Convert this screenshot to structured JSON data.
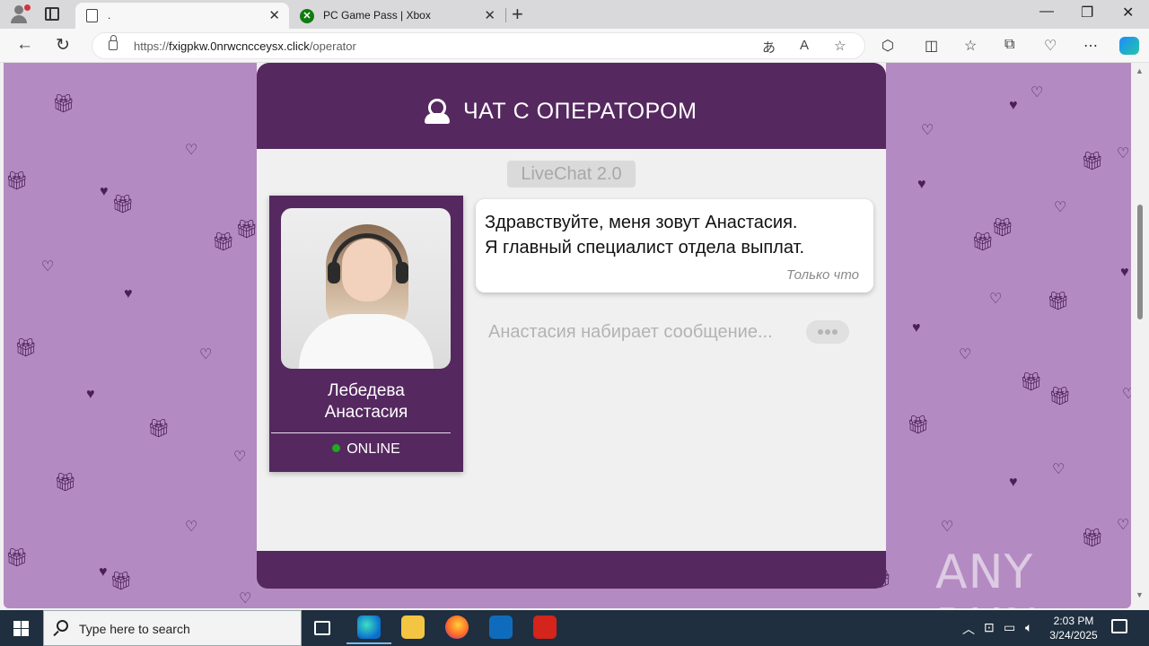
{
  "browser": {
    "tabs": [
      {
        "title": ".",
        "active": true
      },
      {
        "title": "PC Game Pass | Xbox",
        "active": false
      }
    ],
    "url_prefix": "https://",
    "url_host": "fxigpkw.0nrwcncceysx.click",
    "url_path": "/operator"
  },
  "chat": {
    "header_title": "ЧАТ С ОПЕРАТОРОМ",
    "badge": "LiveChat 2.0",
    "operator_name_line1": "Лебедева",
    "operator_name_line2": "Анастасия",
    "status": "ONLINE",
    "message_line1": "Здравствуйте, меня зовут Анастасия.",
    "message_line2": "Я главный специалист отдела выплат.",
    "message_time": "Только что",
    "typing_text": "Анастасия набирает сообщение..."
  },
  "watermark": "ANY RUN",
  "taskbar": {
    "search_placeholder": "Type here to search",
    "time": "2:03 PM",
    "date": "3/24/2025"
  },
  "colors": {
    "page_background": "#b48ac2",
    "brand_purple": "#55285f",
    "status_online": "#1faa1f"
  },
  "icons": [
    "profile-icon",
    "tab-actions-icon",
    "document-icon",
    "xbox-icon",
    "back-icon",
    "refresh-icon",
    "lock-icon",
    "translate-icon",
    "read-aloud-icon",
    "star-icon",
    "extensions-icon",
    "split-screen-icon",
    "favorites-icon",
    "collections-icon",
    "performance-icon",
    "more-icon",
    "copilot-icon",
    "operator-icon",
    "gift-icon",
    "heart-icon",
    "windows-icon",
    "search-icon",
    "task-view-icon",
    "edge-icon",
    "explorer-icon",
    "firefox-icon",
    "outlook-icon",
    "acrobat-icon",
    "notification-icon"
  ]
}
